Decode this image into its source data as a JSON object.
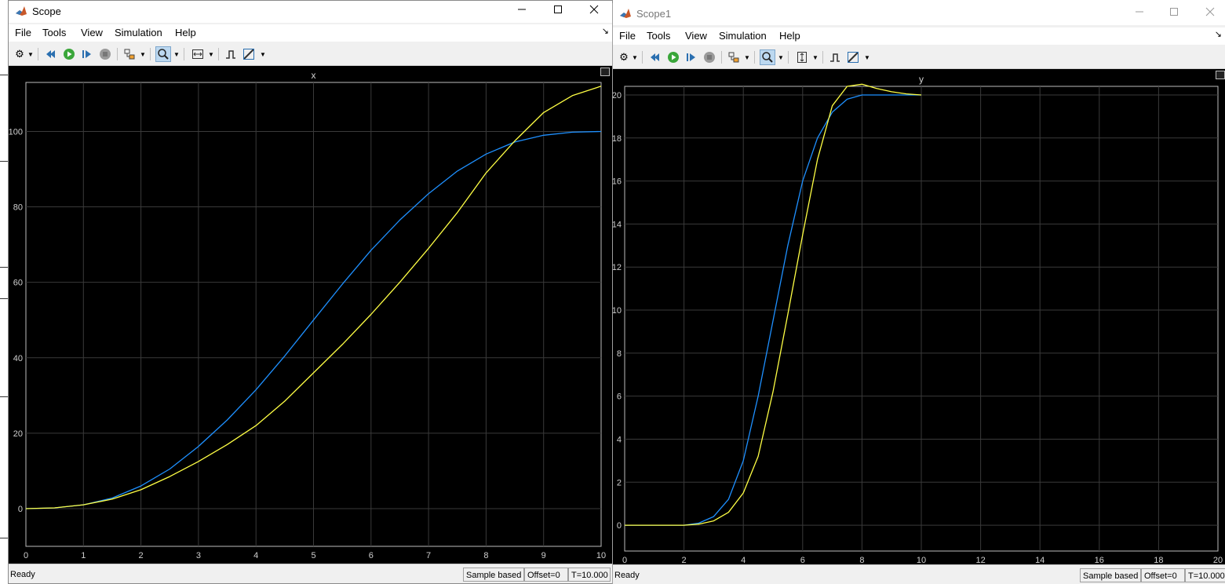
{
  "colors": {
    "plot_bg": "#000000",
    "series_blue": "#1e90ff",
    "series_yellow": "#ffff44",
    "grid": "#3a3a3a",
    "active_tool": "#bcd8f0"
  },
  "window1": {
    "title": "Scope",
    "menu": [
      "File",
      "Tools",
      "View",
      "Simulation",
      "Help"
    ],
    "status": {
      "ready": "Ready",
      "sample": "Sample based",
      "offset": "Offset=0",
      "time": "T=10.000"
    }
  },
  "window2": {
    "title": "Scope1",
    "menu": [
      "File",
      "Tools",
      "View",
      "Simulation",
      "Help"
    ],
    "status": {
      "ready": "Ready",
      "sample": "Sample based",
      "offset": "Offset=0",
      "time": "T=10.000"
    }
  },
  "icons": {
    "minimize": "minimize-icon",
    "maximize": "maximize-icon",
    "close": "close-icon",
    "settings": "gear-icon",
    "step_back": "step-back-icon",
    "run": "run-icon",
    "step_forward": "step-forward-icon",
    "stop": "stop-icon",
    "highlight": "highlight-block-icon",
    "zoom": "zoom-icon",
    "autoscale": "autoscale-icon",
    "triggers": "triggers-icon",
    "measure": "measure-icon"
  },
  "chart_data": [
    {
      "type": "line",
      "title": "x",
      "xlim": [
        0,
        10
      ],
      "ylim": [
        -10,
        113
      ],
      "xticks": [
        "0",
        "1",
        "2",
        "3",
        "4",
        "5",
        "6",
        "7",
        "8",
        "9",
        "10"
      ],
      "yticks": [
        "0",
        "20",
        "40",
        "60",
        "80",
        "100"
      ],
      "grid": true,
      "series": [
        {
          "color": "#1e90ff",
          "x": [
            0,
            0.5,
            1,
            1.5,
            2,
            2.5,
            3,
            3.5,
            4,
            4.5,
            5,
            5.5,
            6,
            6.5,
            7,
            7.5,
            8,
            8.5,
            9,
            9.5,
            10
          ],
          "y": [
            0,
            0.2,
            1,
            2.8,
            6,
            10.5,
            16.5,
            23.5,
            31.5,
            40.5,
            50,
            59.5,
            68.5,
            76.5,
            83.5,
            89.5,
            94,
            97.2,
            99,
            99.8,
            100
          ]
        },
        {
          "color": "#ffff44",
          "x": [
            0,
            0.5,
            1,
            1.5,
            2,
            2.5,
            3,
            3.5,
            4,
            4.5,
            5,
            5.5,
            6,
            6.5,
            7,
            7.5,
            8,
            8.5,
            9,
            9.5,
            10
          ],
          "y": [
            0,
            0.2,
            1,
            2.5,
            5,
            8.5,
            12.5,
            17,
            22,
            28.5,
            36,
            43.5,
            51.5,
            60,
            69,
            78.5,
            89,
            97.5,
            105,
            109.5,
            112
          ]
        }
      ]
    },
    {
      "type": "line",
      "title": "y",
      "xlim": [
        0,
        20
      ],
      "ylim": [
        -1.2,
        20.4
      ],
      "xticks": [
        "0",
        "2",
        "4",
        "6",
        "8",
        "10",
        "12",
        "14",
        "16",
        "18",
        "20"
      ],
      "yticks": [
        "0",
        "2",
        "4",
        "6",
        "8",
        "10",
        "12",
        "14",
        "16",
        "18",
        "20"
      ],
      "grid": true,
      "series": [
        {
          "color": "#1e90ff",
          "x": [
            0,
            2,
            2.5,
            3,
            3.5,
            4,
            4.5,
            5,
            5.5,
            6,
            6.5,
            7,
            7.5,
            8,
            8.5,
            9,
            9.5,
            10
          ],
          "y": [
            0,
            0,
            0.1,
            0.4,
            1.2,
            3,
            6,
            9.5,
            13,
            16,
            18,
            19.2,
            19.8,
            20,
            20,
            20,
            20,
            20
          ]
        },
        {
          "color": "#ffff44",
          "x": [
            0,
            2,
            2.5,
            3,
            3.5,
            4,
            4.5,
            5,
            5.5,
            6,
            6.5,
            7,
            7.5,
            8,
            8.5,
            9,
            9.5,
            10
          ],
          "y": [
            0,
            0,
            0.05,
            0.2,
            0.6,
            1.5,
            3.2,
            6.2,
            9.8,
            13.5,
            17,
            19.5,
            20.4,
            20.5,
            20.3,
            20.15,
            20.05,
            20
          ]
        }
      ]
    }
  ]
}
